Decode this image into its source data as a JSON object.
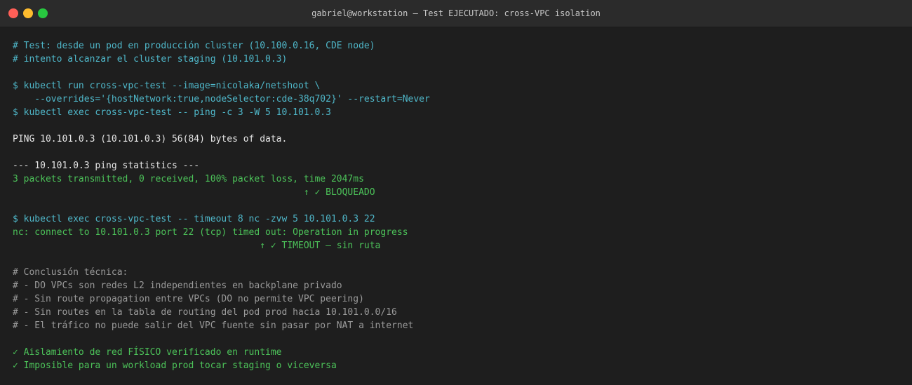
{
  "window": {
    "title": "gabriel@workstation — Test EJECUTADO: cross-VPC isolation"
  },
  "terminal": {
    "lines": [
      {
        "kind": "comment",
        "text": "# Test: desde un pod en producción cluster (10.100.0.16, CDE node)"
      },
      {
        "kind": "comment",
        "text": "# intento alcanzar el cluster staging (10.101.0.3)"
      },
      {
        "kind": "blank",
        "text": ""
      },
      {
        "kind": "cmd",
        "text": "$ kubectl run cross-vpc-test --image=nicolaka/netshoot \\"
      },
      {
        "kind": "cmd",
        "text": "    --overrides='{hostNetwork:true,nodeSelector:cde-38q702}' --restart=Never"
      },
      {
        "kind": "cmd",
        "text": "$ kubectl exec cross-vpc-test -- ping -c 3 -W 5 10.101.0.3"
      },
      {
        "kind": "blank",
        "text": ""
      },
      {
        "kind": "out",
        "text": "PING 10.101.0.3 (10.101.0.3) 56(84) bytes of data."
      },
      {
        "kind": "blank",
        "text": ""
      },
      {
        "kind": "out",
        "text": "--- 10.101.0.3 ping statistics ---"
      },
      {
        "kind": "ok",
        "text": "3 packets transmitted, 0 received, 100% packet loss, time 2047ms"
      },
      {
        "kind": "ok",
        "text": "                                                     ↑ ✓ BLOQUEADO"
      },
      {
        "kind": "blank",
        "text": ""
      },
      {
        "kind": "cmd",
        "text": "$ kubectl exec cross-vpc-test -- timeout 8 nc -zvw 5 10.101.0.3 22"
      },
      {
        "kind": "ok",
        "text": "nc: connect to 10.101.0.3 port 22 (tcp) timed out: Operation in progress"
      },
      {
        "kind": "ok",
        "text": "                                             ↑ ✓ TIMEOUT — sin ruta"
      },
      {
        "kind": "blank",
        "text": ""
      },
      {
        "kind": "note",
        "text": "# Conclusión técnica:"
      },
      {
        "kind": "note",
        "text": "# - DO VPCs son redes L2 independientes en backplane privado"
      },
      {
        "kind": "note",
        "text": "# - Sin route propagation entre VPCs (DO no permite VPC peering)"
      },
      {
        "kind": "note",
        "text": "# - Sin routes en la tabla de routing del pod prod hacia 10.101.0.0/16"
      },
      {
        "kind": "note",
        "text": "# - El tráfico no puede salir del VPC fuente sin pasar por NAT a internet"
      },
      {
        "kind": "blank",
        "text": ""
      },
      {
        "kind": "ok",
        "text": "✓ Aislamiento de red FÍSICO verificado en runtime"
      },
      {
        "kind": "ok",
        "text": "✓ Imposible para un workload prod tocar staging o viceversa"
      }
    ]
  }
}
